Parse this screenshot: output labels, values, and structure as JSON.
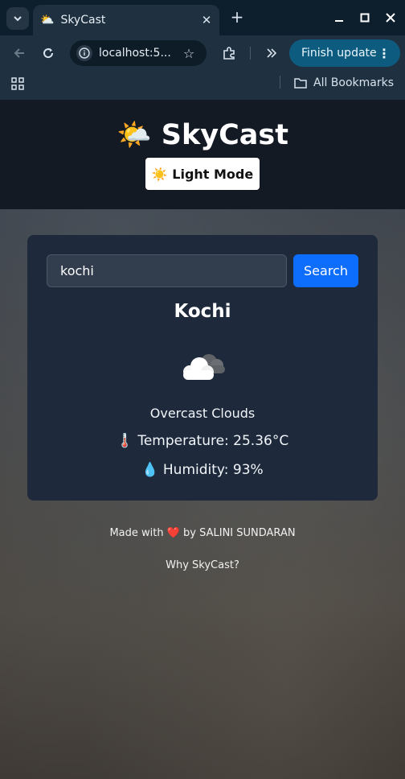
{
  "browser": {
    "tab_title": "SkyCast",
    "tab_favicon": "⛅",
    "url": "localhost:5...",
    "update_button": "Finish update",
    "bookmarks_label": "All Bookmarks"
  },
  "app": {
    "brand": "🌤️ SkyCast",
    "mode_button": "☀️ Light Mode",
    "search": {
      "value": "kochi",
      "button": "Search"
    },
    "weather": {
      "city": "Kochi",
      "icon": "overcast-clouds-icon",
      "description": "Overcast Clouds",
      "temperature": "🌡️ Temperature: 25.36°C",
      "humidity": "💧 Humidity: 93%"
    },
    "footer": {
      "made_with": "Made with ❤️ by SALINI SUNDARAN",
      "why_link": "Why SkyCast?"
    }
  },
  "colors": {
    "header_bg": "#141a24",
    "card_bg": "#1e293b",
    "primary": "#0d6efd",
    "update_button": "#0d5c80"
  }
}
